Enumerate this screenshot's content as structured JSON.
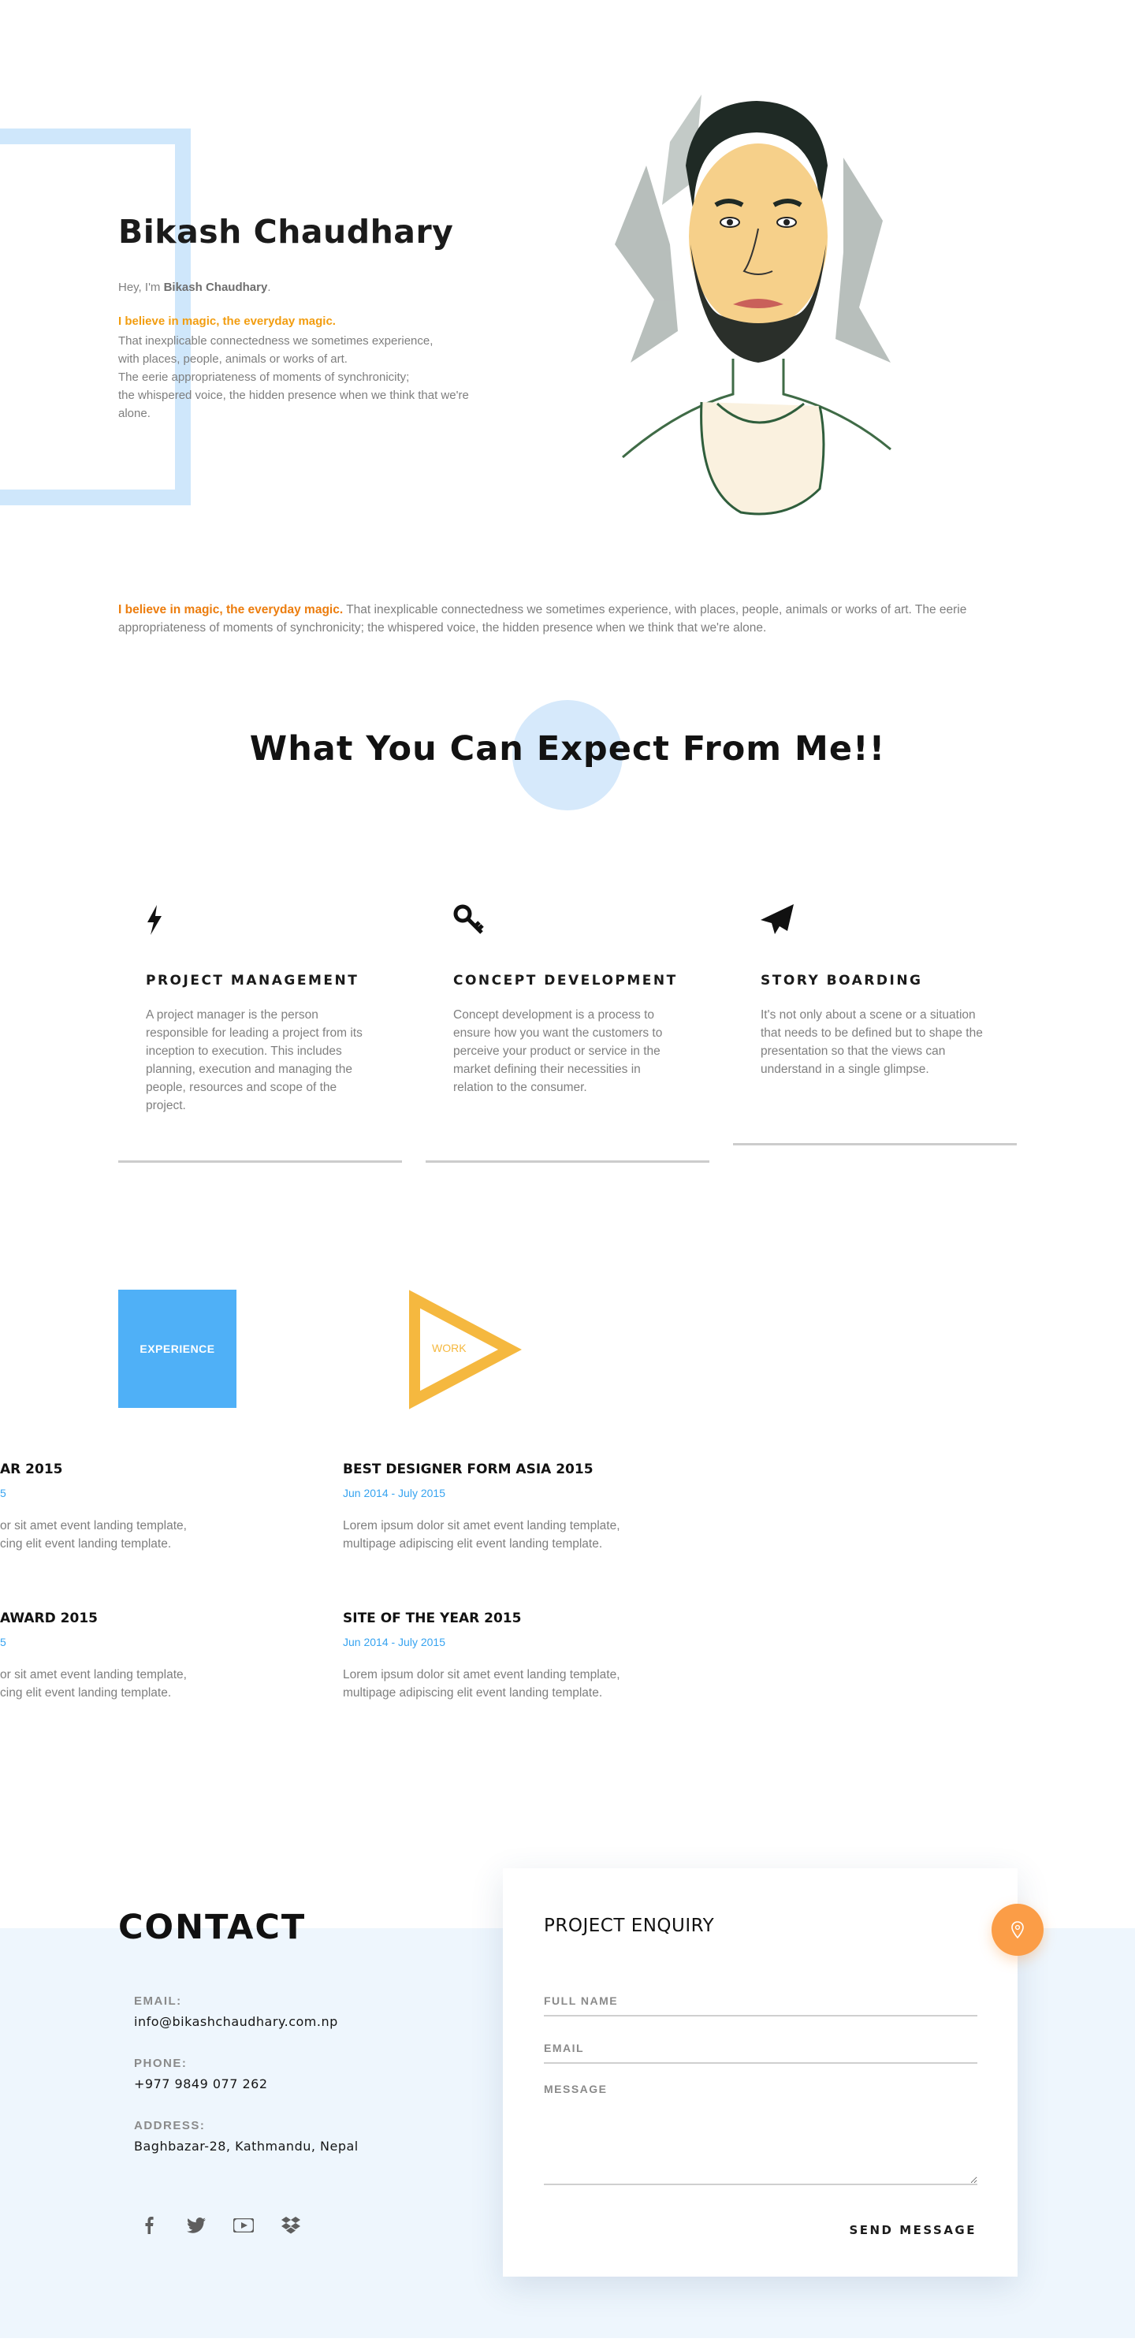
{
  "hero": {
    "name": "Bikash Chaudhary",
    "greeting_prefix": "Hey, I'm ",
    "greeting_name": "Bikash Chaudhary",
    "greeting_suffix": ".",
    "tagline": "I believe in magic, the everyday magic.",
    "lines": [
      "That inexplicable connectedness we sometimes experience,",
      "with places, people, animals or works of art.",
      "The eerie appropriateness of moments of synchronicity;",
      "the whispered voice, the hidden presence when we think that we're",
      "alone."
    ]
  },
  "intro": {
    "highlight": "I believe in magic, the everyday magic.",
    "text": " That inexplicable connectedness we sometimes experience, with places, people, animals or works of art. The eerie appropriateness of moments of synchronicity; the whispered voice, the hidden presence when we think that we're alone."
  },
  "expect": {
    "title": "What You Can Expect From Me!!",
    "services": [
      {
        "icon": "bolt-icon",
        "title": "PROJECT MANAGEMENT",
        "desc": "A project manager is the person responsible for leading a project from its inception to execution. This includes planning, execution and managing the people, resources and scope of the project."
      },
      {
        "icon": "key-icon",
        "title": "CONCEPT DEVELOPMENT",
        "desc": "Concept development is a process to ensure how you want the customers to perceive your product or service in the market defining their necessities in relation to the consumer."
      },
      {
        "icon": "paper-plane-icon",
        "title": "STORY BOARDING",
        "desc": "It's not only about a scene or a situation that needs to be defined but to shape the presentation so that the views can understand in a single glimpse."
      }
    ]
  },
  "resume": {
    "experience_label": "EXPERIENCE",
    "work_label": "WORK",
    "colors": {
      "experience": "#4fb0f7",
      "work": "#f5b83f",
      "date": "#36a3f0"
    },
    "left_items": [
      {
        "title": "AR 2015",
        "date": "5",
        "desc_1": "or sit amet event landing template,",
        "desc_2": "cing elit event landing template."
      },
      {
        "title": "AWARD 2015",
        "date": "5",
        "desc_1": "or sit amet event landing template,",
        "desc_2": "cing elit event landing template."
      }
    ],
    "right_items": [
      {
        "title": "BEST DESIGNER FORM ASIA 2015",
        "date": "Jun 2014 - July 2015",
        "desc_1": "Lorem ipsum dolor sit amet event landing template,",
        "desc_2": "multipage adipiscing elit event landing template."
      },
      {
        "title": "SITE OF THE YEAR 2015",
        "date": "Jun 2014 - July 2015",
        "desc_1": "Lorem ipsum dolor sit amet event landing template,",
        "desc_2": "multipage adipiscing elit event landing template."
      }
    ]
  },
  "contact": {
    "title": "CONTACT",
    "email_label": "EMAIL:",
    "email": "info@bikashchaudhary.com.np",
    "phone_label": "PHONE:",
    "phone": "+977 9849 077 262",
    "address_label": "ADDRESS:",
    "address": "Baghbazar-28, Kathmandu, Nepal",
    "socials": [
      "facebook-icon",
      "twitter-icon",
      "youtube-icon",
      "dropbox-icon"
    ]
  },
  "enquiry": {
    "title": "PROJECT ENQUIRY",
    "full_name_placeholder": "FULL NAME",
    "email_placeholder": "EMAIL",
    "message_placeholder": "MESSAGE",
    "send_label": "SEND MESSAGE",
    "pin_color": "#fb9d47"
  }
}
